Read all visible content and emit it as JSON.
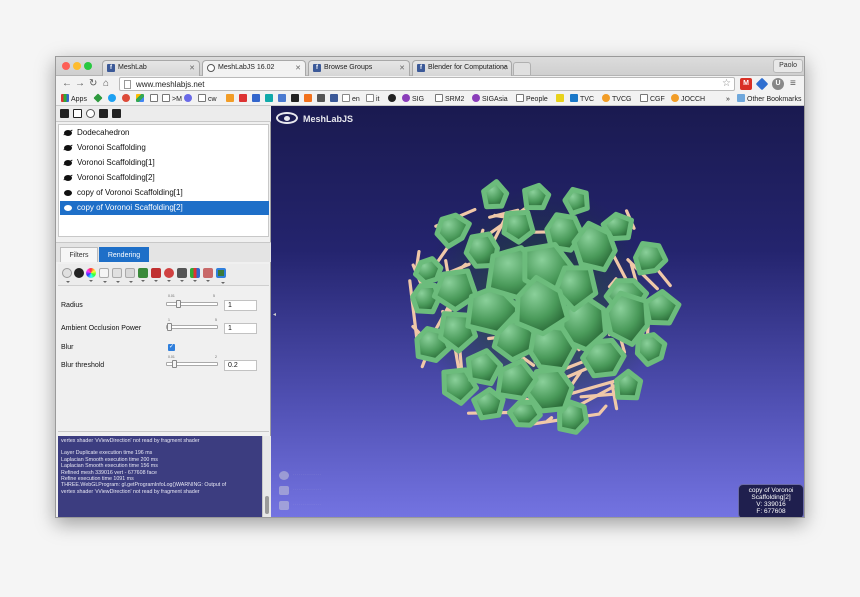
{
  "browser": {
    "tabs": [
      {
        "label": "MeshLab",
        "active": false
      },
      {
        "label": "MeshLabJS 16.02",
        "active": true
      },
      {
        "label": "Browse Groups",
        "active": false
      },
      {
        "label": "Blender for Computationa",
        "active": false
      }
    ],
    "profile": "Paolo",
    "url": "www.meshlabjs.net",
    "bookmarks": [
      "Apps",
      ">M",
      "cw",
      "en",
      "it",
      "SIG",
      "SRM2",
      "SIGAsia",
      "People",
      "TVC",
      "TVCG",
      "CGF",
      "JOCCH"
    ],
    "other_bookmarks": "Other Bookmarks",
    "more": "»"
  },
  "layers": [
    {
      "name": "Dodecahedron",
      "visible": false
    },
    {
      "name": "Voronoi Scaffolding",
      "visible": false
    },
    {
      "name": "Voronoi Scaffolding[1]",
      "visible": false
    },
    {
      "name": "Voronoi Scaffolding[2]",
      "visible": false
    },
    {
      "name": "copy of Voronoi Scaffolding[1]",
      "visible": true
    },
    {
      "name": "copy of Voronoi Scaffolding[2]",
      "visible": true,
      "selected": true
    }
  ],
  "panel_tabs": {
    "filters": "Filters",
    "rendering": "Rendering"
  },
  "params": {
    "radius": {
      "label": "Radius",
      "min": "0.01",
      "max": "5",
      "value": "1",
      "fraction": 0.2
    },
    "ao_power": {
      "label": "Ambient Occlusion Power",
      "min": "1",
      "max": "5",
      "value": "1",
      "fraction": 0.0
    },
    "blur": {
      "label": "Blur",
      "checked": true,
      "mark": "✓"
    },
    "blur_threshold": {
      "label": "Blur threshold",
      "min": "0.01",
      "max": "2",
      "value": "0.2",
      "fraction": 0.1
    }
  },
  "log": [
    "vertex shader 'vViewDirection' not read by fragment shader",
    "",
    "Layer Duplicate execution time 196 ms",
    "Laplacian Smooth execution time 200 ms",
    "Laplacian Smooth execution time 156 ms",
    "Refined mesh 339016 vert - 677608 face",
    "Refine execution time 1091 ms",
    "THREE.WebGLProgram: gl.getProgramInfoLog()WARNING: Output of",
    "vertex shader 'vViewDirection' not read by fragment shader"
  ],
  "viewport": {
    "brand": "MeshLabJS",
    "info": {
      "line1": "copy of Voronoi",
      "line2": "Scaffolding[2]",
      "vertices": "V: 339016",
      "faces": "F: 677608"
    },
    "colors": {
      "mesh": "#4a9a5a",
      "struts": "#f0c8a8",
      "bg_top": "#1a1a50",
      "bg_bottom": "#7474e2"
    }
  }
}
